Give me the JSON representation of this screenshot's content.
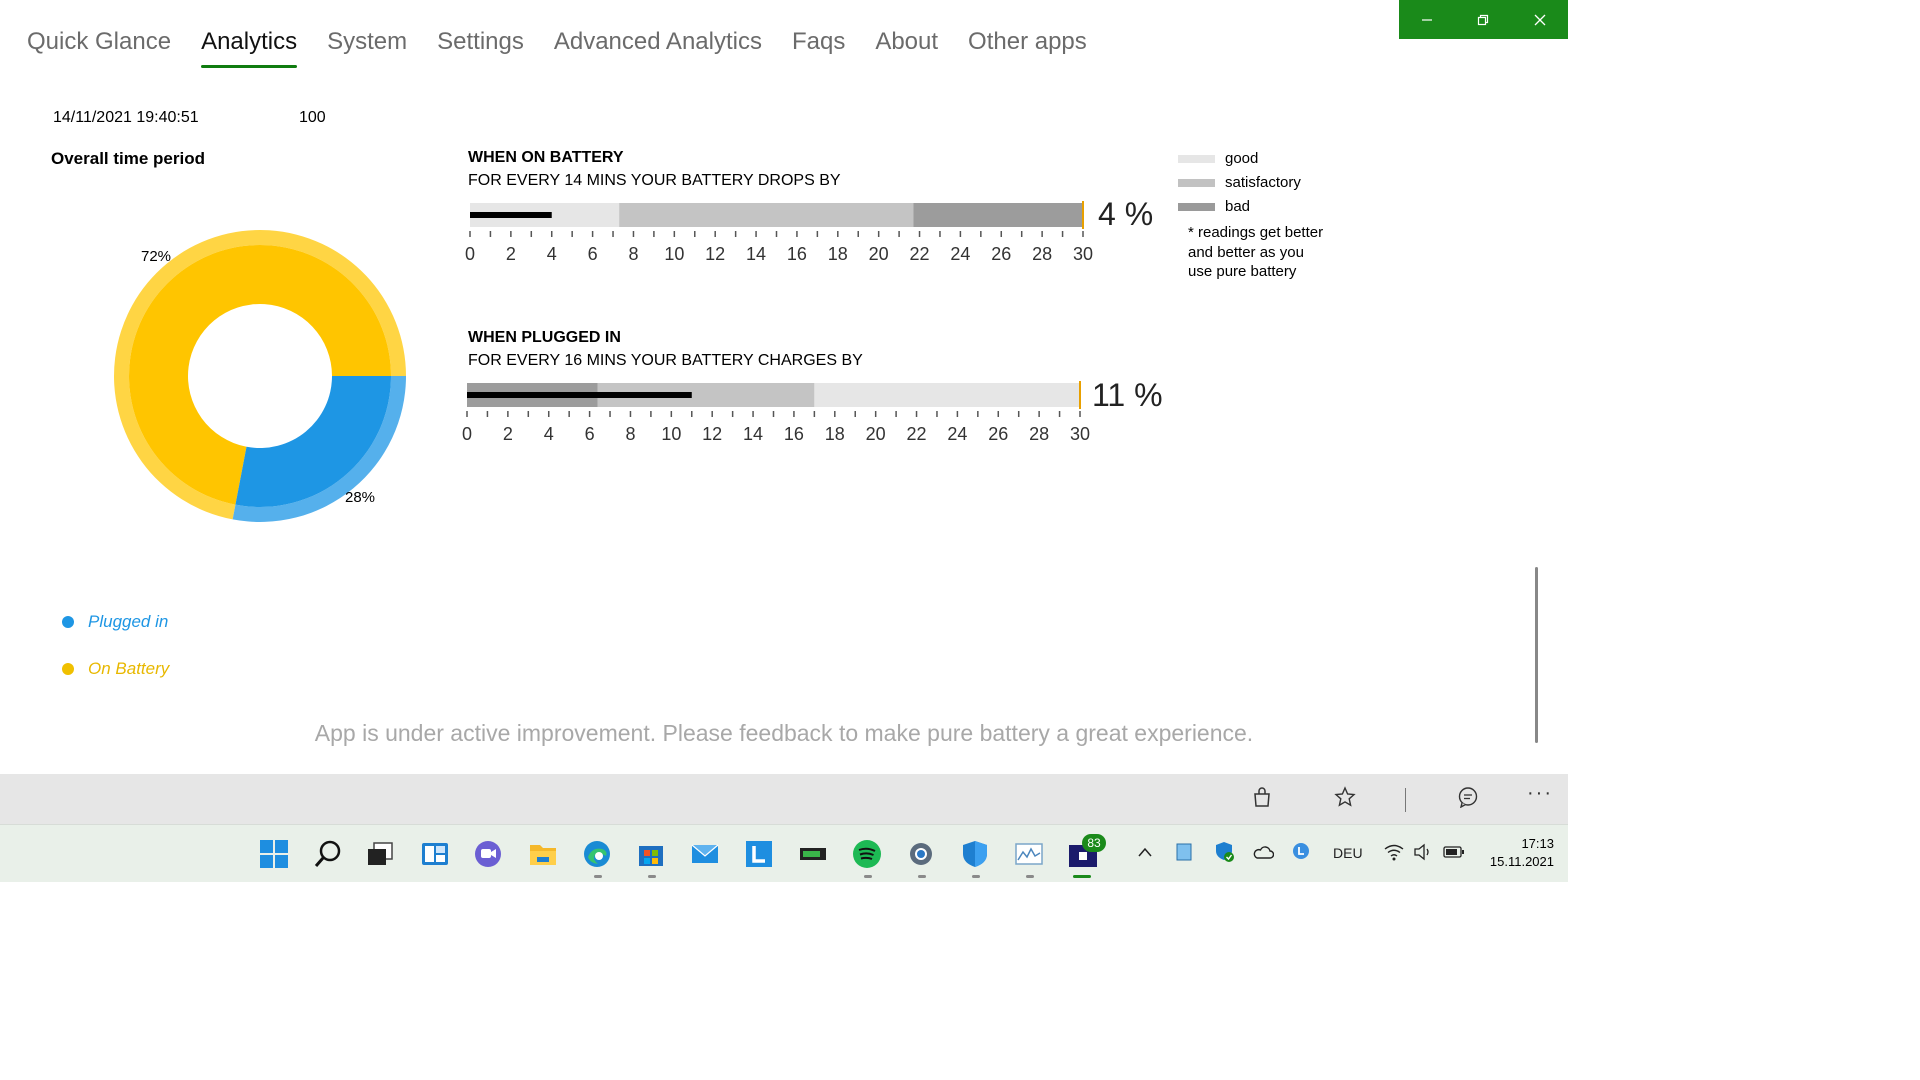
{
  "nav": {
    "items": [
      "Quick Glance",
      "Analytics",
      "System",
      "Settings",
      "Advanced Analytics",
      "Faqs",
      "About",
      "Other apps"
    ],
    "active_index": 1
  },
  "window_controls": {
    "minimize": "minimize-icon",
    "restore": "restore-icon",
    "close": "close-icon",
    "accent": "#1a8a1a"
  },
  "header": {
    "timestamp": "14/11/2021 19:40:51",
    "value": "100"
  },
  "overall": {
    "title": "Overall time period",
    "chart_data": {
      "type": "pie",
      "categories": [
        "On Battery",
        "Plugged in"
      ],
      "values": [
        72,
        28
      ],
      "labels": [
        "72%",
        "28%"
      ],
      "colors": [
        "#ffc500",
        "#1e96e4"
      ]
    },
    "legend": [
      {
        "label": "Plugged in",
        "color": "#1e96e4"
      },
      {
        "label": "On Battery",
        "color": "#f0c000"
      }
    ]
  },
  "battery": {
    "title": "WHEN ON BATTERY",
    "subtitle": "FOR EVERY 14 MINS YOUR BATTERY DROPS BY",
    "value": 4,
    "value_label": "4 %",
    "bands": [
      {
        "from": 0,
        "to": 7.3,
        "level": "good"
      },
      {
        "from": 7.3,
        "to": 21.7,
        "level": "satisfactory"
      },
      {
        "from": 21.7,
        "to": 30,
        "level": "bad"
      }
    ],
    "ticks": [
      "0",
      "2",
      "4",
      "6",
      "8",
      "10",
      "12",
      "14",
      "16",
      "18",
      "20",
      "22",
      "24",
      "26",
      "28",
      "30"
    ]
  },
  "plugged": {
    "title": "WHEN PLUGGED IN",
    "subtitle": "FOR EVERY 16 MINS YOUR BATTERY CHARGES BY",
    "value": 11,
    "value_label": "11 %",
    "bands": [
      {
        "from": 0,
        "to": 6.4,
        "level": "bad"
      },
      {
        "from": 6.4,
        "to": 17,
        "level": "satisfactory"
      },
      {
        "from": 17,
        "to": 30,
        "level": "good"
      }
    ],
    "ticks": [
      "0",
      "2",
      "4",
      "6",
      "8",
      "10",
      "12",
      "14",
      "16",
      "18",
      "20",
      "22",
      "24",
      "26",
      "28",
      "30"
    ]
  },
  "key": {
    "items": [
      {
        "label": "good",
        "color": "#e6e6e6"
      },
      {
        "label": "satisfactory",
        "color": "#c2c2c2"
      },
      {
        "label": "bad",
        "color": "#9a9a9a"
      }
    ],
    "note": "* readings get better and better as you use pure battery"
  },
  "footer_message": "App is under active improvement. Please feedback to make pure battery a great experience.",
  "command_bar": [
    "bag-icon",
    "star-icon",
    "comment-icon",
    "more-icon"
  ],
  "taskbar": {
    "apps": [
      "start-icon",
      "search-icon",
      "task-view-icon",
      "widgets-icon",
      "chat-icon",
      "file-explorer-icon",
      "edge-icon",
      "store-icon",
      "mail-icon",
      "l-app-icon",
      "battery-app-icon",
      "spotify-icon",
      "settings-icon",
      "defender-icon",
      "monitor-icon",
      "pure-battery-icon"
    ],
    "badge": "83",
    "tray_language": "DEU",
    "time": "17:13",
    "date": "15.11.2021"
  }
}
